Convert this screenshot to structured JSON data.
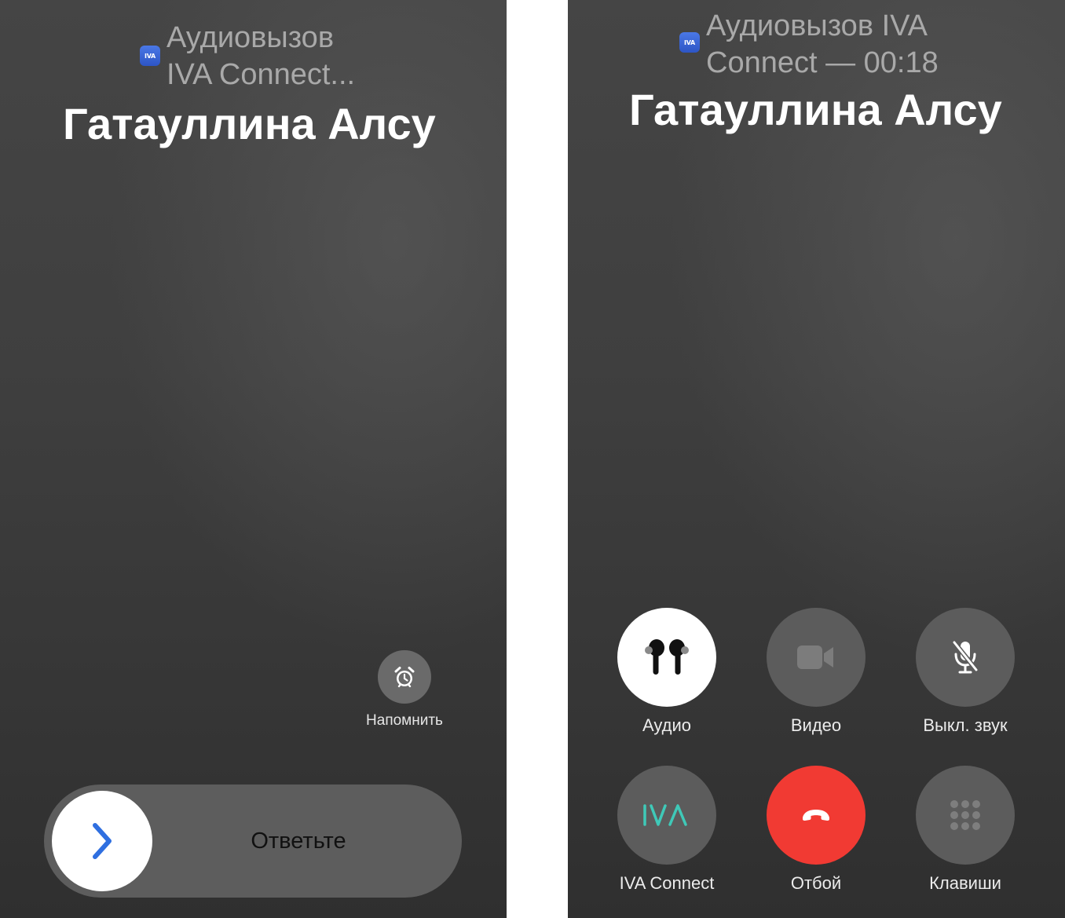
{
  "incoming_call": {
    "app_icon_text": "IVA",
    "status_line1": "Аудиовызов",
    "status_line2": "IVA Connect...",
    "caller_name": "Гатауллина Алсу",
    "remind_icon": "alarm-clock-icon",
    "remind_label": "Напомнить",
    "slider_icon": "chevron-right-icon",
    "slider_text": "Ответьте",
    "colors": {
      "chevron": "#2f6fe0",
      "app_icon": "#3a63d6"
    }
  },
  "active_call": {
    "app_icon_text": "IVA",
    "status_line1": "Аудиовызов IVA",
    "status_line2": "Connect — 00:18",
    "caller_name": "Гатауллина Алсу",
    "controls": [
      {
        "label": "Аудио",
        "icon": "airpods-icon",
        "active": true
      },
      {
        "label": "Видео",
        "icon": "video-camera-icon",
        "active": false
      },
      {
        "label": "Выкл. звук",
        "icon": "microphone-slash-icon",
        "active": false
      },
      {
        "label": "IVA Connect",
        "icon": "iva-logo-icon",
        "active": false
      },
      {
        "label": "Отбой",
        "icon": "end-call-icon",
        "active": false
      },
      {
        "label": "Клавиши",
        "icon": "keypad-icon",
        "active": false
      }
    ],
    "colors": {
      "end_call": "#f13a33",
      "iva_logo": "#3fc9b8"
    }
  }
}
